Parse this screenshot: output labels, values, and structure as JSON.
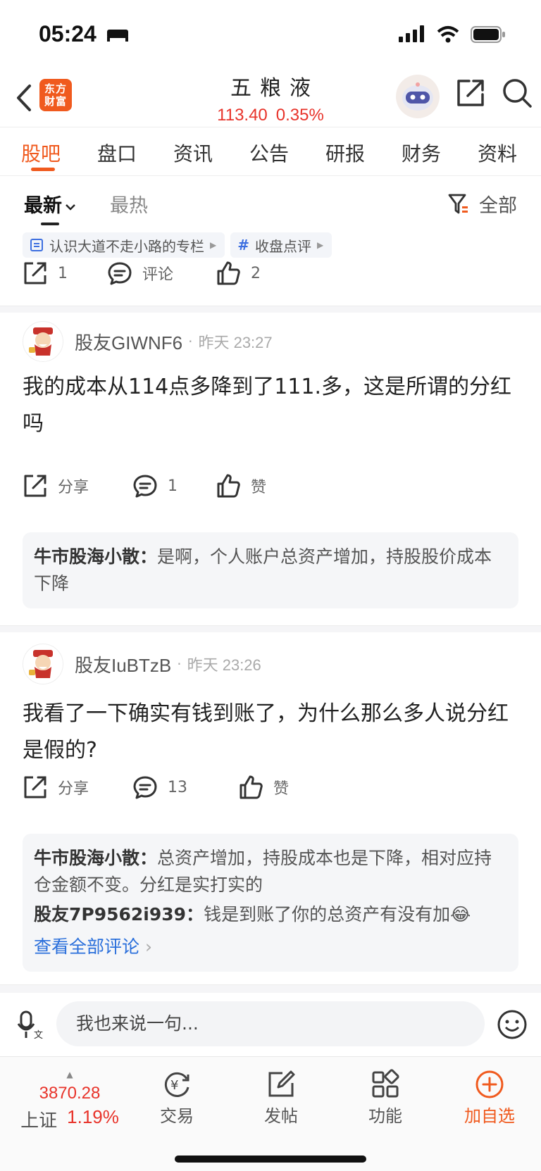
{
  "status": {
    "time": "05:24"
  },
  "header": {
    "logo_text_1": "东方",
    "logo_text_2": "财富",
    "title": "五粮液",
    "price": "113.40",
    "change": "0.35%"
  },
  "tabs": [
    "股吧",
    "盘口",
    "资讯",
    "公告",
    "研报",
    "财务",
    "资料"
  ],
  "sort": {
    "newest": "最新",
    "hot": "最热",
    "filter": "全部"
  },
  "chips": [
    {
      "label": "认识大道不走小路的专栏"
    },
    {
      "label": "收盘点评"
    }
  ],
  "top_actions": {
    "share_count": "1",
    "comment_label": "评论",
    "like_count": "2"
  },
  "posts": [
    {
      "user": "股友GIWNF6",
      "time": "昨天 23:27",
      "body": "我的成本从114点多降到了111.多，这是所谓的分红吗",
      "share_label": "分享",
      "comment_count": "1",
      "like_label": "赞",
      "comments": [
        {
          "author": "牛市股海小散：",
          "text": "是啊，个人账户总资产增加，持股股价成本下降"
        }
      ]
    },
    {
      "user": "股友IuBTzB",
      "time": "昨天 23:26",
      "body": "我看了一下确实有钱到账了，为什么那么多人说分红是假的?",
      "share_label": "分享",
      "comment_count": "13",
      "like_label": "赞",
      "comments": [
        {
          "author": "牛市股海小散：",
          "text": "总资产增加，持股成本也是下降，相对应持仓金额不变。分红是实打实的"
        },
        {
          "author": "股友7P9562i939：",
          "text": "钱是到账了你的总资产有没有加"
        }
      ],
      "see_all": "查看全部评论"
    }
  ],
  "input": {
    "placeholder": "我也来说一句..."
  },
  "bottom": {
    "index_value": "3870.28",
    "index_name": "上证",
    "index_change": "1.19%",
    "trade": "交易",
    "post": "发帖",
    "functions": "功能",
    "add_watch": "加自选"
  },
  "colors": {
    "accent": "#f05a1e",
    "up": "#e8332a",
    "link": "#2a6fdb"
  }
}
